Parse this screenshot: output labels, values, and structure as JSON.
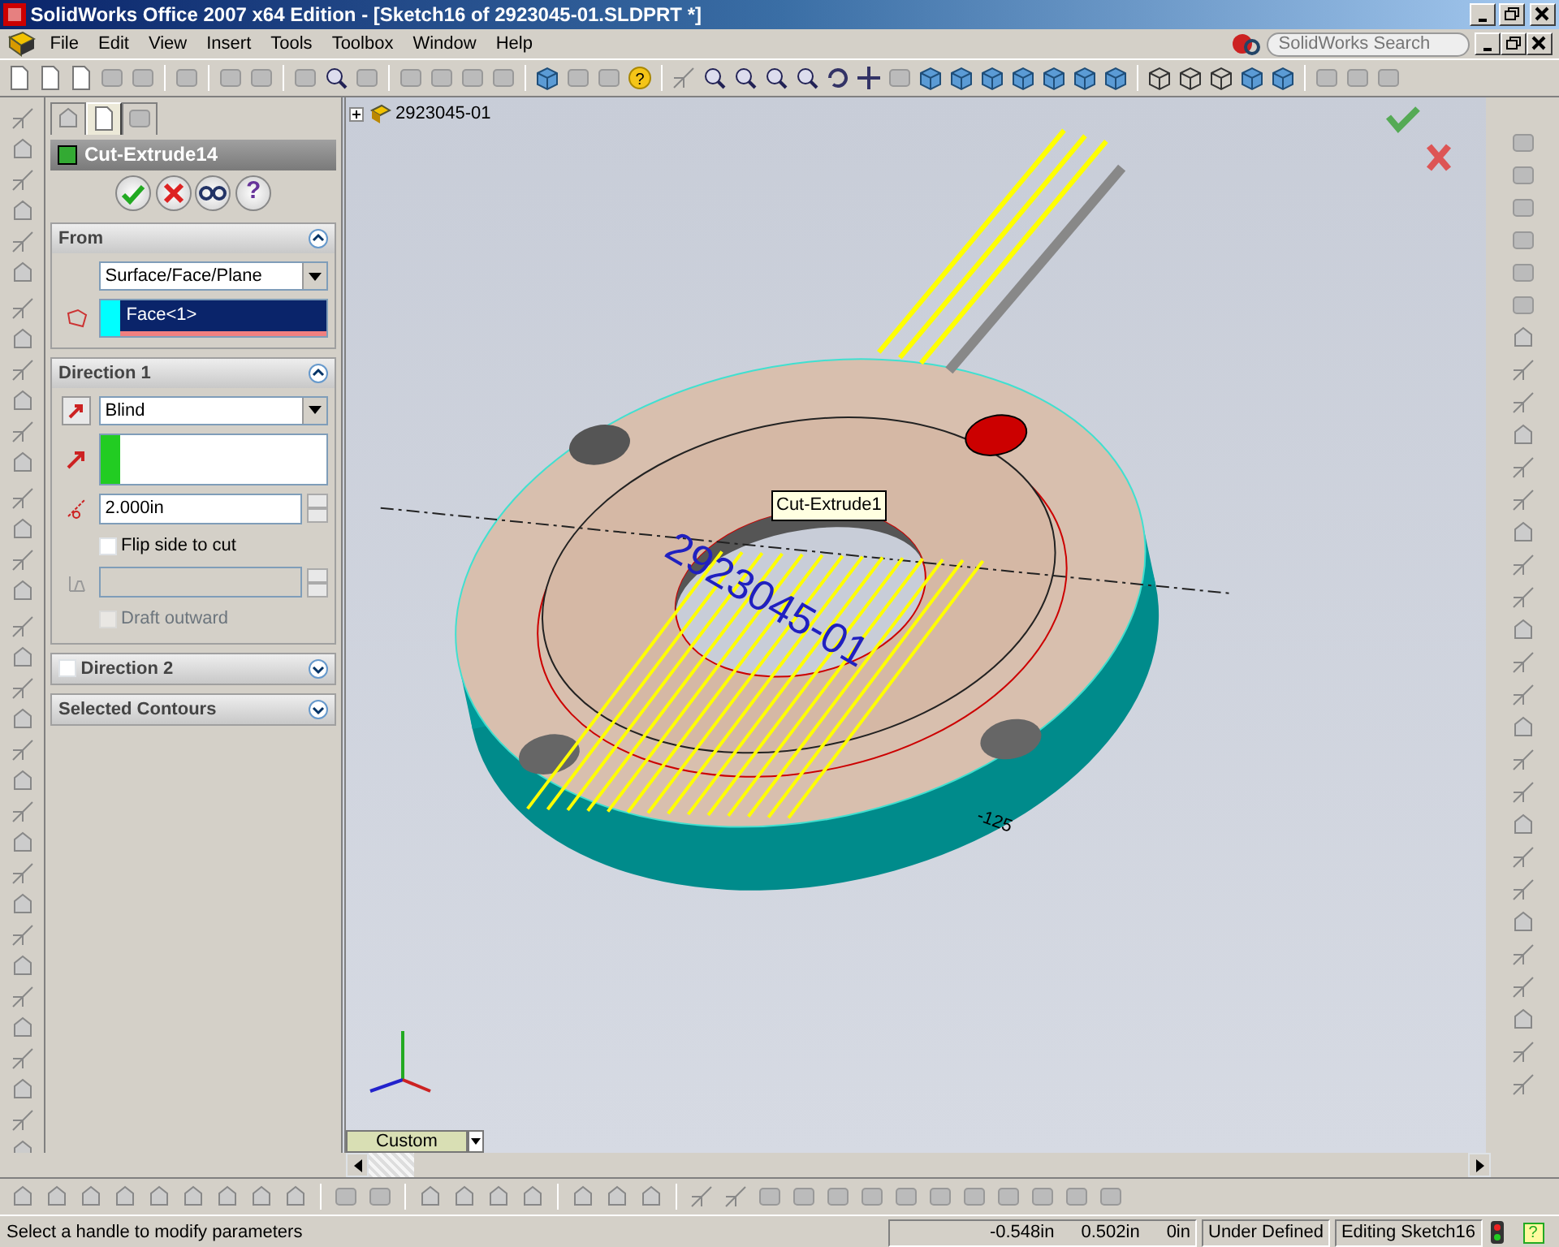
{
  "window": {
    "title": "SolidWorks Office 2007 x64 Edition - [Sketch16 of 2923045-01.SLDPRT *]"
  },
  "menu": [
    {
      "label": "File"
    },
    {
      "label": "Edit"
    },
    {
      "label": "View"
    },
    {
      "label": "Insert"
    },
    {
      "label": "Tools"
    },
    {
      "label": "Toolbox"
    },
    {
      "label": "Window"
    },
    {
      "label": "Help"
    }
  ],
  "search": {
    "placeholder": "SolidWorks Search"
  },
  "toolbar": {
    "help_glyph": "?"
  },
  "panel_tabs": [
    {
      "selected": false
    },
    {
      "selected": true
    },
    {
      "selected": false
    }
  ],
  "property_manager": {
    "title": "Cut-Extrude14",
    "help_button": "?",
    "from": {
      "title": "From",
      "expanded": true,
      "start_condition": "Surface/Face/Plane",
      "selection": "Face<1>"
    },
    "direction1": {
      "title": "Direction 1",
      "expanded": true,
      "end_condition": "Blind",
      "depth": "2.000in",
      "flip": {
        "label": "Flip side to cut",
        "checked": false
      },
      "draft_angle": {
        "disabled": true
      },
      "draft_outward": {
        "label": "Draft outward",
        "checked": false,
        "disabled": true
      }
    },
    "direction2": {
      "title": "Direction 2",
      "checked": false,
      "expanded": false
    },
    "selected_contours": {
      "title": "Selected Contours",
      "expanded": false
    }
  },
  "viewport": {
    "tree_root": "2923045-01",
    "tooltip": "Cut-Extrude1",
    "engraved_text": "2923045-01",
    "dimension": "-125",
    "display_state": "Custom"
  },
  "status_bar": {
    "message": "Select a handle to modify parameters",
    "x": "-0.548in",
    "y": "0.502in",
    "z": "0in",
    "sketch_state": "Under Defined",
    "mode": "Editing Sketch16",
    "help_glyph": "?"
  }
}
